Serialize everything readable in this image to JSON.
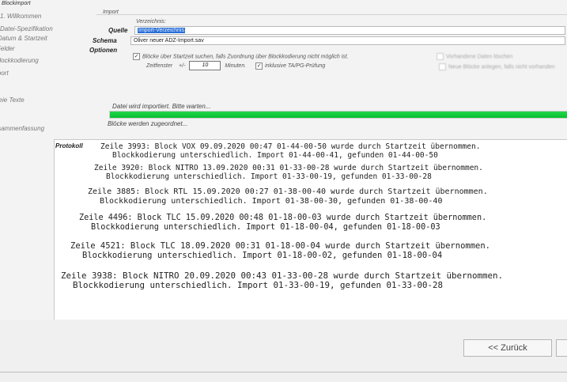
{
  "window": {
    "title": "Blockimport"
  },
  "nav": {
    "items": [
      {
        "label": "1. Willkommen"
      },
      {
        "label": "Datei-Spezifikation"
      },
      {
        "label": "Datum & Startzeit"
      },
      {
        "label": "Felder"
      },
      {
        "label": "Blockkodierung"
      },
      {
        "label": "Import"
      },
      {
        "label": "Freie Texte"
      },
      {
        "label": "Zusammenfassung"
      }
    ]
  },
  "import": {
    "group_title": "Import",
    "source_label": "Quelle",
    "source_hint": "Verzeichnis:",
    "source_value": "Import-Verzeichnis",
    "schema_label": "Schema",
    "schema_value": "Oliver neuer ADZ-Import.sav",
    "options_label": "Optionen",
    "checkbox_blocks": "Blöcke über Startzeit suchen, falls Zuordnung über Blockkodierung nicht möglich ist.",
    "time_window_label": "Zeitfenster",
    "plus_minus": "+/-",
    "time_window_value": "10",
    "minutes_label": "Minuten.",
    "checkbox_inclusive": "inklusive TA/PG-Prüfung",
    "right_option_1": "Vorhandene Daten löschen",
    "right_option_2": "Neue Blöcke anlegen, falls nicht vorhanden"
  },
  "progress": {
    "status_text": "Datei wird importiert. Bitte warten...",
    "percent": 100,
    "sub_status": "Blöcke werden zugeordnet..."
  },
  "protokoll": {
    "label": "Protokoll",
    "entries": [
      {
        "line1": "Zeile 3993: Block VOX 09.09.2020 00:47 01-44-00-50 wurde durch Startzeit übernommen.",
        "line2": "Blockkodierung unterschiedlich. Import 01-44-00-41, gefunden 01-44-00-50"
      },
      {
        "line1": "Zeile 3920: Block NITRO 13.09.2020 00:31 01-33-00-28 wurde durch Startzeit übernommen.",
        "line2": "Blockkodierung unterschiedlich. Import 01-33-00-19, gefunden 01-33-00-28"
      },
      {
        "line1": "Zeile 3885: Block RTL 15.09.2020 00:27 01-38-00-40 wurde durch Startzeit übernommen.",
        "line2": "Blockkodierung unterschiedlich. Import 01-38-00-30, gefunden 01-38-00-40"
      },
      {
        "line1": "Zeile 4496: Block TLC 15.09.2020 00:48 01-18-00-03 wurde durch Startzeit übernommen.",
        "line2": "Blockkodierung unterschiedlich. Import 01-18-00-04, gefunden 01-18-00-03"
      },
      {
        "line1": "Zeile 4521: Block TLC 18.09.2020 00:31 01-18-00-04 wurde durch Startzeit übernommen.",
        "line2": "Blockkodierung unterschiedlich. Import 01-18-00-02, gefunden 01-18-00-04"
      },
      {
        "line1": "Zeile 3938: Block NITRO 20.09.2020 00:43 01-33-00-28 wurde durch Startzeit übernommen.",
        "line2": "Blockkodierung unterschiedlich. Import 01-33-00-19, gefunden 01-33-00-28"
      }
    ]
  },
  "buttons": {
    "back": "<< Zurück"
  }
}
